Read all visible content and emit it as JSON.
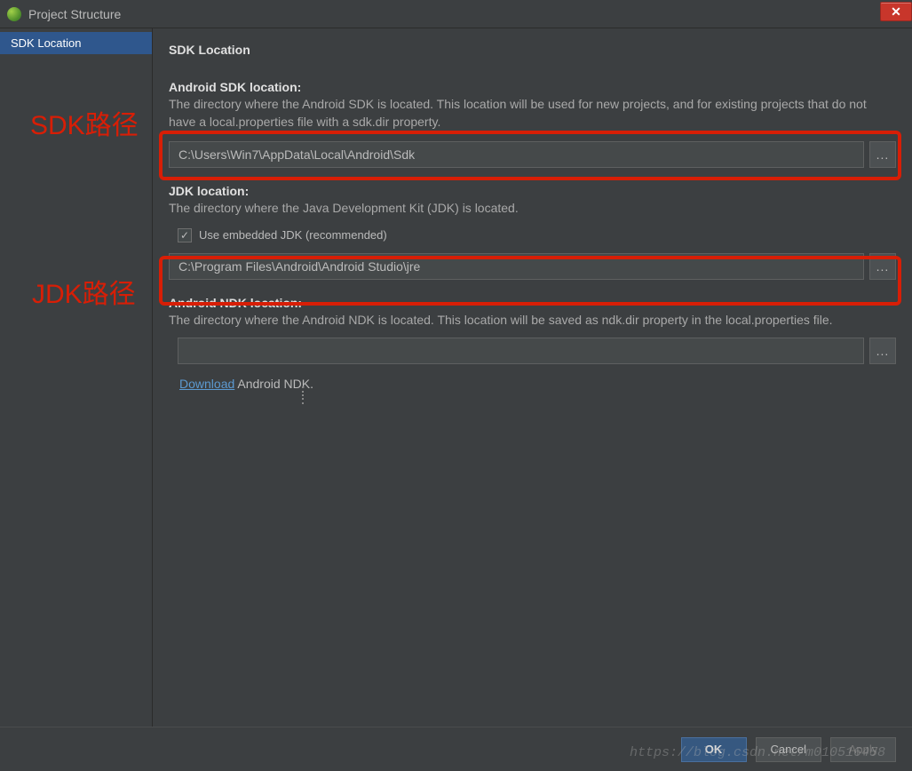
{
  "window": {
    "title": "Project Structure"
  },
  "sidebar": {
    "items": [
      {
        "label": "SDK Location"
      }
    ]
  },
  "main": {
    "title": "SDK Location",
    "sdk": {
      "label": "Android SDK location:",
      "desc": "The directory where the Android SDK is located. This location will be used for new projects, and for existing projects that do not have a local.properties file with a sdk.dir property.",
      "value": "C:\\Users\\Win7\\AppData\\Local\\Android\\Sdk",
      "browse": "...",
      "callout": "SDK路径"
    },
    "jdk": {
      "label": "JDK location:",
      "desc": "The directory where the Java Development Kit (JDK) is located.",
      "embedded_label": "Use embedded JDK (recommended)",
      "embedded_checked": true,
      "value": "C:\\Program Files\\Android\\Android Studio\\jre",
      "browse": "...",
      "callout": "JDK路径"
    },
    "ndk": {
      "label": "Android NDK location:",
      "desc": "The directory where the Android NDK is located. This location will be saved as ndk.dir property in the local.properties file.",
      "value": "",
      "browse": "...",
      "download_link": "Download",
      "download_rest": " Android NDK."
    }
  },
  "buttons": {
    "ok": "OK",
    "cancel": "Cancel",
    "apply": "Apply"
  },
  "watermark": "https://blog.csdn.net/m010516458"
}
